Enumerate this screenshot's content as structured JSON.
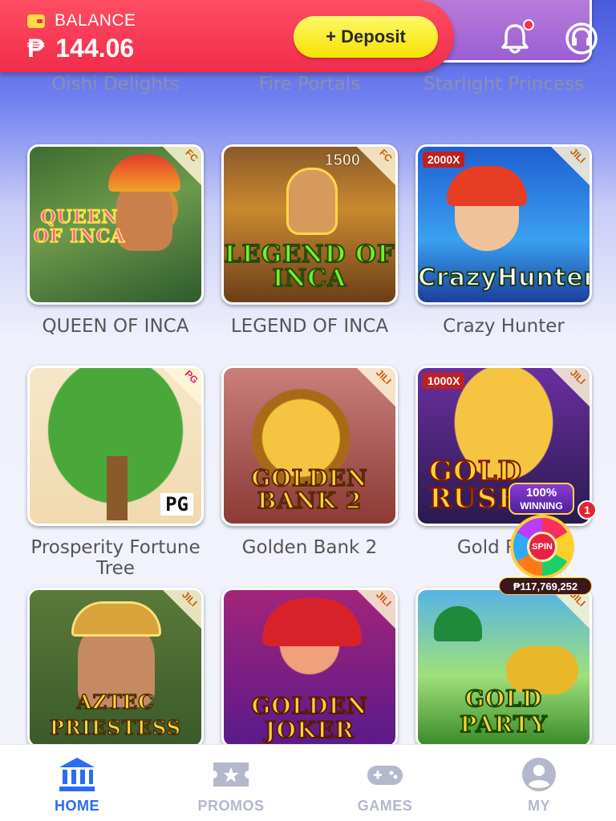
{
  "header": {
    "balance_label": "BALANCE",
    "currency_symbol": "₱",
    "balance_amount": "144.06",
    "deposit_label": "+ Deposit",
    "bell_has_notification": true
  },
  "games": [
    {
      "name": "Oishi Delights",
      "art_title": "",
      "provider": "",
      "theme": "partial"
    },
    {
      "name": "Fire Portals",
      "art_title": "",
      "provider": "",
      "theme": "partial"
    },
    {
      "name": "Starlight Princess",
      "art_title": "",
      "provider": "",
      "theme": "partial"
    },
    {
      "name": "QUEEN OF INCA",
      "art_title": "QUEEN OF INCA",
      "provider": "FC",
      "theme": "jungle"
    },
    {
      "name": "LEGEND OF INCA",
      "art_title": "LEGEND OF INCA",
      "provider": "FC",
      "theme": "gold",
      "corner_value": "1500"
    },
    {
      "name": "Crazy Hunter",
      "art_title": "CrazyHunter",
      "provider": "JILI",
      "theme": "blue",
      "corner_value": "2000X"
    },
    {
      "name": "Prosperity Fortune Tree",
      "art_title": "PG",
      "provider": "PG",
      "theme": "tree"
    },
    {
      "name": "Golden Bank 2",
      "art_title": "GOLDEN BANK 2",
      "provider": "JILI",
      "theme": "bank"
    },
    {
      "name": "Gold Rush",
      "art_title": "GOLD RUSH",
      "provider": "JILI",
      "theme": "rush",
      "corner_value": "1000X"
    },
    {
      "name": "",
      "art_title": "AZTEC PRIESTESS",
      "provider": "JILI",
      "theme": "aztec"
    },
    {
      "name": "",
      "art_title": "GOLDEN JOKER",
      "provider": "JILI",
      "theme": "joker"
    },
    {
      "name": "",
      "art_title": "GOLD PARTY",
      "provider": "JILI",
      "theme": "party"
    }
  ],
  "spin_widget": {
    "win_top": "100%",
    "win_bottom": "WINNING",
    "count": "1",
    "spin_label": "SPIN",
    "jackpot": "₱117,769,252"
  },
  "nav": [
    {
      "label": "HOME",
      "icon": "bank-icon",
      "active": true
    },
    {
      "label": "PROMOS",
      "icon": "ticket-icon",
      "active": false
    },
    {
      "label": "GAMES",
      "icon": "gamepad-icon",
      "active": false
    },
    {
      "label": "MY",
      "icon": "user-icon",
      "active": false
    }
  ]
}
